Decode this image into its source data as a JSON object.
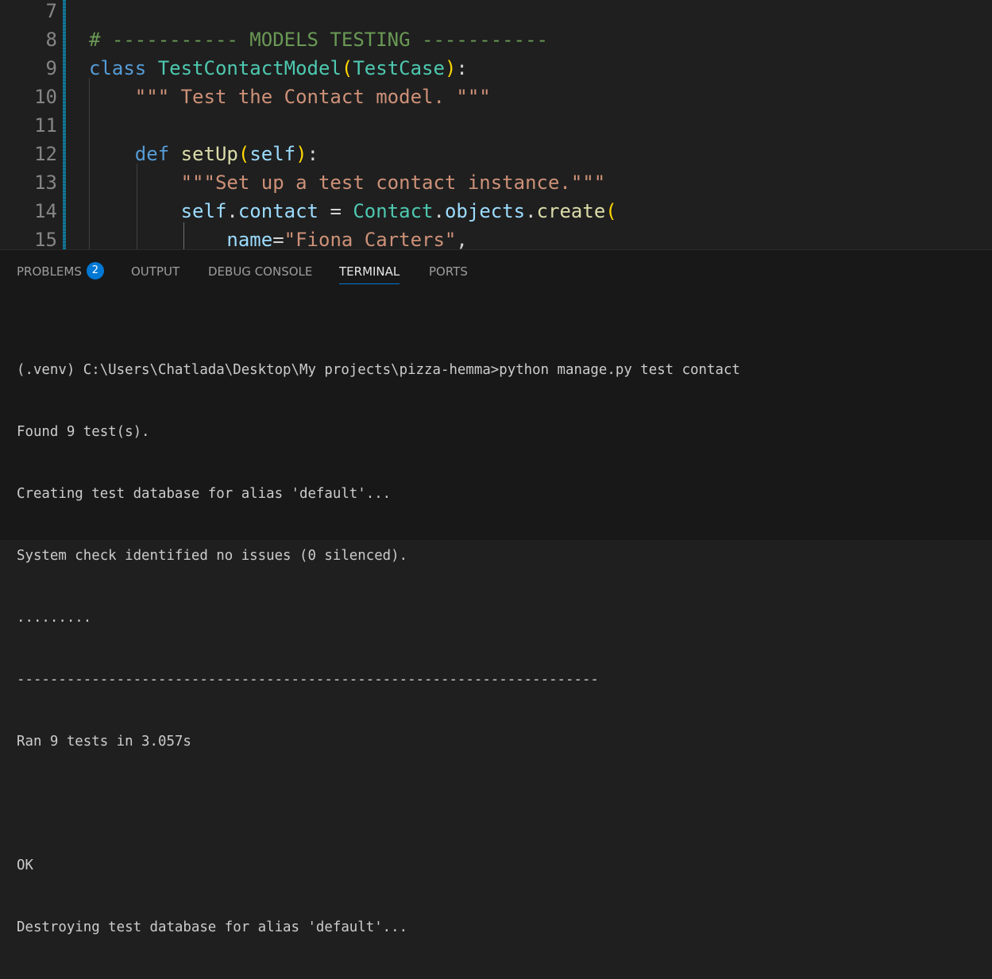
{
  "editor": {
    "lines": [
      {
        "num": "7",
        "tokens": []
      },
      {
        "num": "8",
        "tokens": [
          {
            "t": "# ----------- MODELS TESTING -----------",
            "c": "c-comment"
          }
        ]
      },
      {
        "num": "9",
        "tokens": [
          {
            "t": "class",
            "c": "c-kw"
          },
          {
            "t": " ",
            "c": ""
          },
          {
            "t": "TestContactModel",
            "c": "c-cls"
          },
          {
            "t": "(",
            "c": "c-br1"
          },
          {
            "t": "TestCase",
            "c": "c-cls"
          },
          {
            "t": ")",
            "c": "c-br1"
          },
          {
            "t": ":",
            "c": "c-op"
          }
        ]
      },
      {
        "num": "10",
        "tokens": [
          {
            "t": "    \"\"\" Test the Contact model. \"\"\"",
            "c": "c-str"
          }
        ]
      },
      {
        "num": "11",
        "tokens": []
      },
      {
        "num": "12",
        "tokens": [
          {
            "t": "    ",
            "c": ""
          },
          {
            "t": "def",
            "c": "c-kw"
          },
          {
            "t": " ",
            "c": ""
          },
          {
            "t": "setUp",
            "c": "c-fn"
          },
          {
            "t": "(",
            "c": "c-br1"
          },
          {
            "t": "self",
            "c": "c-var"
          },
          {
            "t": ")",
            "c": "c-br1"
          },
          {
            "t": ":",
            "c": "c-op"
          }
        ]
      },
      {
        "num": "13",
        "tokens": [
          {
            "t": "        \"\"\"Set up a test contact instance.\"\"\"",
            "c": "c-str"
          }
        ]
      },
      {
        "num": "14",
        "tokens": [
          {
            "t": "        ",
            "c": ""
          },
          {
            "t": "self",
            "c": "c-var"
          },
          {
            "t": ".",
            "c": "c-op"
          },
          {
            "t": "contact",
            "c": "c-var"
          },
          {
            "t": " = ",
            "c": "c-op"
          },
          {
            "t": "Contact",
            "c": "c-cls"
          },
          {
            "t": ".",
            "c": "c-op"
          },
          {
            "t": "objects",
            "c": "c-var"
          },
          {
            "t": ".",
            "c": "c-op"
          },
          {
            "t": "create",
            "c": "c-fn"
          },
          {
            "t": "(",
            "c": "c-br1"
          }
        ]
      },
      {
        "num": "15",
        "tokens": [
          {
            "t": "            ",
            "c": ""
          },
          {
            "t": "name",
            "c": "c-var"
          },
          {
            "t": "=",
            "c": "c-op"
          },
          {
            "t": "\"Fiona Carters\"",
            "c": "c-str"
          },
          {
            "t": ",",
            "c": "c-op"
          }
        ]
      }
    ]
  },
  "panel": {
    "tabs": [
      {
        "label": "PROBLEMS",
        "badge": "2"
      },
      {
        "label": "OUTPUT"
      },
      {
        "label": "DEBUG CONSOLE"
      },
      {
        "label": "TERMINAL",
        "active": true
      },
      {
        "label": "PORTS"
      }
    ]
  },
  "terminal": {
    "lines": [
      "(.venv) C:\\Users\\Chatlada\\Desktop\\My projects\\pizza-hemma>python manage.py test contact",
      "Found 9 test(s).",
      "Creating test database for alias 'default'...",
      "System check identified no issues (0 silenced).",
      ".........",
      "----------------------------------------------------------------------",
      "Ran 9 tests in 3.057s",
      "",
      "OK",
      "Destroying test database for alias 'default'..."
    ]
  }
}
